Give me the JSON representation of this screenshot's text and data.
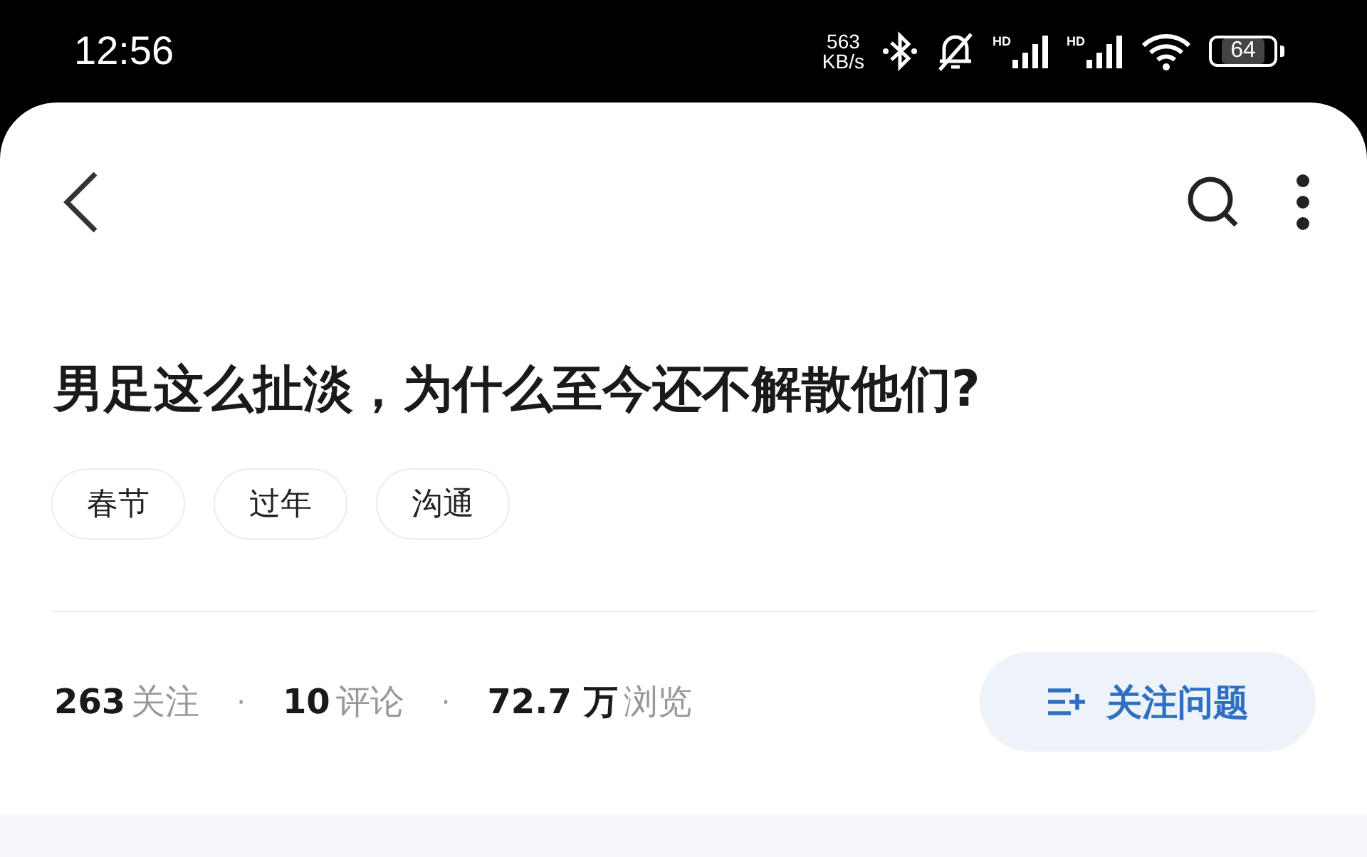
{
  "status_bar": {
    "time": "12:56",
    "speed_value": "563",
    "speed_unit": "KB/s",
    "signals": [
      {
        "label": "HD"
      },
      {
        "label": "HD"
      }
    ],
    "battery": "64"
  },
  "question": {
    "title": "男足这么扯淡，为什么至今还不解散他们?",
    "tags": [
      "春节",
      "过年",
      "沟通"
    ],
    "stats": [
      {
        "value": "263",
        "label": "关注"
      },
      {
        "separator": "·",
        "value": "10",
        "label": "评论"
      },
      {
        "separator": "·",
        "value": "72.7 万",
        "label": "浏览"
      }
    ],
    "follow_button": "关注问题"
  }
}
